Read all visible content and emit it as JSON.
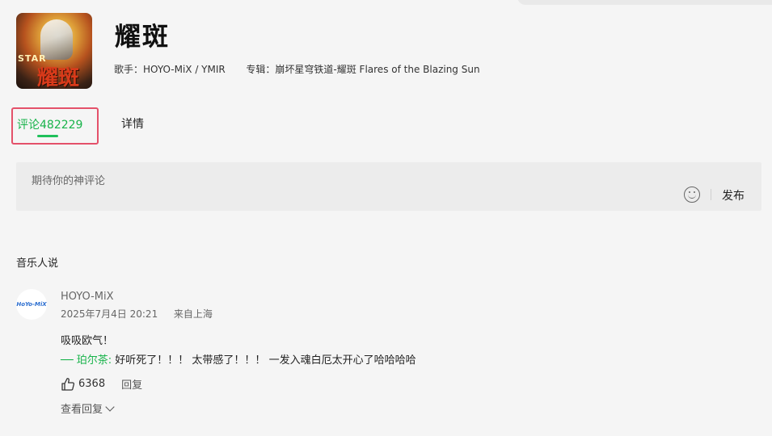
{
  "song": {
    "title": "耀斑",
    "artist_line": "歌手：HOYO-MiX / YMIR",
    "album_line": "专辑：崩坏星穹铁道-耀斑 Flares of the Blazing Sun",
    "cover_text_top": "STAR",
    "cover_text_main": "耀斑"
  },
  "tabs": {
    "comments_label": "评论482229",
    "details_label": "详情"
  },
  "compose": {
    "placeholder": "期待你的神评论",
    "publish_label": "发布",
    "emoji_icon": "emoji-icon"
  },
  "section": {
    "title": "音乐人说"
  },
  "comment": {
    "avatar_text": "HoYo-MiX",
    "username": "HOYO-MiX",
    "time": "2025年7月4日 20:21",
    "location": "来自上海",
    "text": "吸吸欧气！",
    "reply_name": "── 珀尔茶:",
    "reply_text": " 好听死了！！！ 太带感了！！！ 一发入魂白厄太开心了哈哈哈哈",
    "likes": "6368",
    "reply_label": "回复",
    "view_replies_label": "查看回复"
  },
  "colors": {
    "accent_green": "#18b34a",
    "highlight_red": "#e4516a",
    "background": "#f5f5f5"
  }
}
